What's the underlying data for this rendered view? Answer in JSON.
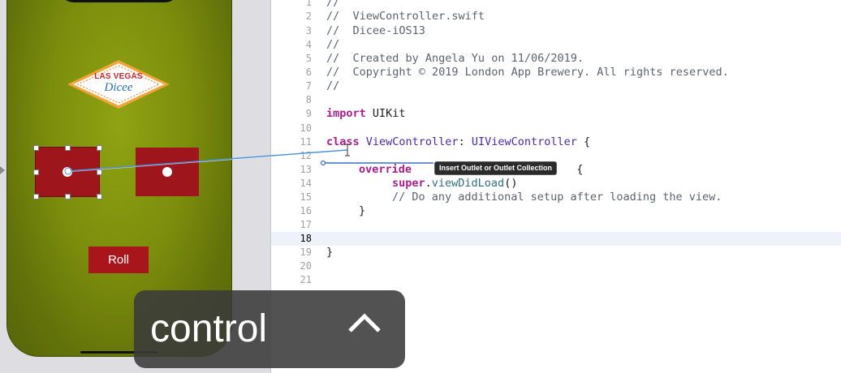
{
  "storyboard": {
    "logo_top": "LAS VEGAS",
    "logo_bottom": "Dicee",
    "roll_button_label": "Roll"
  },
  "editor": {
    "lines": [
      {
        "num": "1",
        "text": "//"
      },
      {
        "num": "2",
        "text": "//  ViewController.swift"
      },
      {
        "num": "3",
        "text": "//  Dicee-iOS13"
      },
      {
        "num": "4",
        "text": "//"
      },
      {
        "num": "5",
        "text": "//  Created by Angela Yu on 11/06/2019."
      },
      {
        "num": "6",
        "text": "//  Copyright © 2019 London App Brewery. All rights reserved."
      },
      {
        "num": "7",
        "text": "//"
      },
      {
        "num": "8",
        "text": ""
      },
      {
        "num": "9",
        "kw": "import",
        "rest": " UIKit"
      },
      {
        "num": "10",
        "text": ""
      },
      {
        "num": "11",
        "kw": "class",
        "name": " ViewController",
        "colon": ": ",
        "type": "UIViewController",
        "tail": " {"
      },
      {
        "num": "12",
        "text": ""
      },
      {
        "num": "13",
        "kw": "override",
        "tail": "                         {"
      },
      {
        "num": "14",
        "kw": "super",
        "dot": ".",
        "fn": "viewDidLoad",
        "tail": "()"
      },
      {
        "num": "15",
        "comment": "// Do any additional setup after loading the view."
      },
      {
        "num": "16",
        "text": "}"
      },
      {
        "num": "17",
        "text": ""
      },
      {
        "num": "18",
        "text": ""
      },
      {
        "num": "19",
        "text": "}"
      },
      {
        "num": "20",
        "text": ""
      },
      {
        "num": "21",
        "text": ""
      }
    ],
    "tooltip": "Insert Outlet or Outlet Collection"
  },
  "overlay": {
    "key_label": "control"
  }
}
